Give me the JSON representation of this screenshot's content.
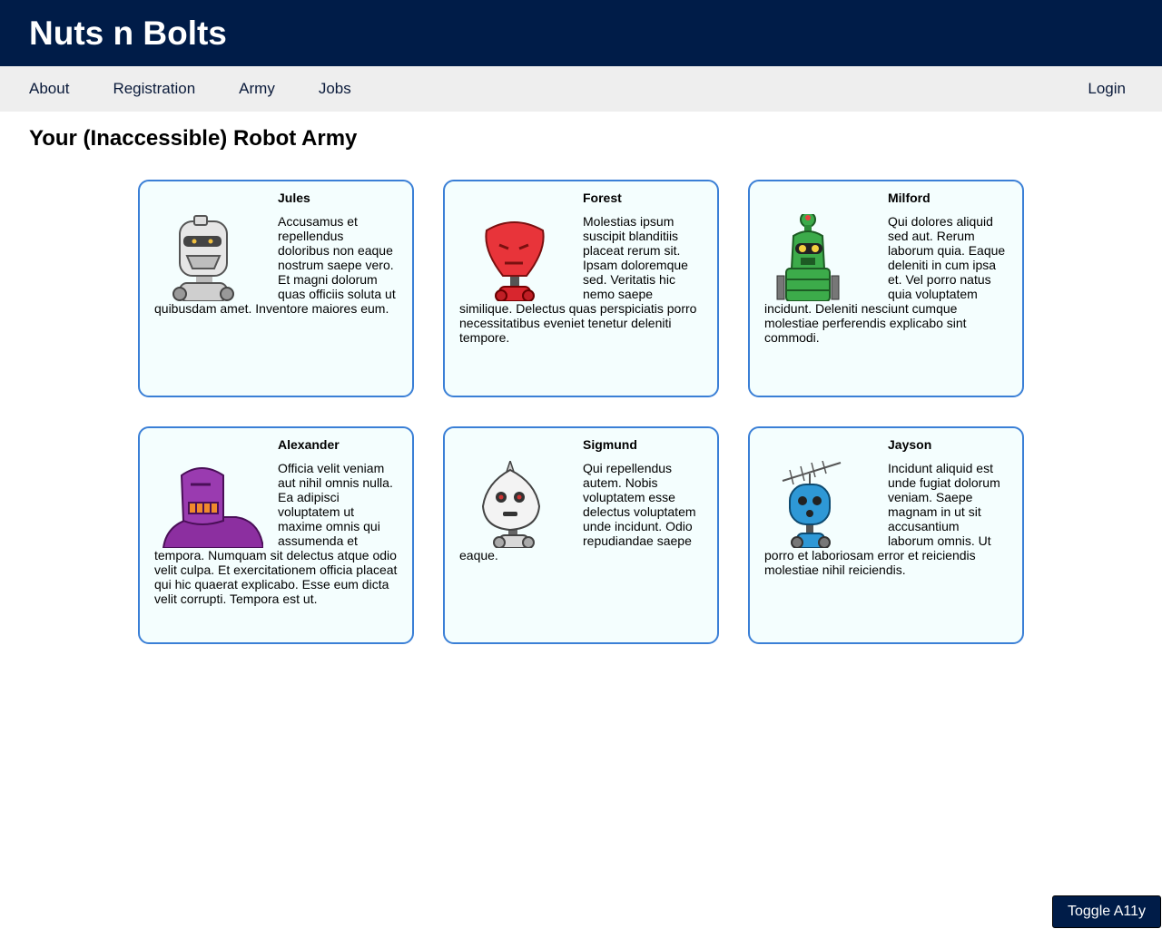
{
  "header": {
    "title": "Nuts n Bolts"
  },
  "nav": {
    "about": "About",
    "registration": "Registration",
    "army": "Army",
    "jobs": "Jobs",
    "login": "Login"
  },
  "main": {
    "title": "Your (Inaccessible) Robot Army"
  },
  "robots": [
    {
      "name": "Jules",
      "description": "Accusamus et repellendus doloribus non eaque nostrum saepe vero. Et magni dolorum quas officiis soluta ut quibusdam amet. Inventore maiores eum.",
      "color": "#d8d8d8"
    },
    {
      "name": "Forest",
      "description": "Molestias ipsum suscipit blanditiis placeat rerum sit. Ipsam doloremque sed. Veritatis hic nemo saepe similique. Delectus quas perspiciatis porro necessitatibus eveniet tenetur deleniti tempore.",
      "color": "#e8343a"
    },
    {
      "name": "Milford",
      "description": "Qui dolores aliquid sed aut. Rerum laborum quia. Eaque deleniti in cum ipsa et. Vel porro natus quia voluptatem incidunt. Deleniti nesciunt cumque molestiae perferendis explicabo sint commodi.",
      "color": "#3cab4a"
    },
    {
      "name": "Alexander",
      "description": "Officia velit veniam aut nihil omnis nulla. Ea adipisci voluptatem ut maxime omnis qui assumenda et tempora. Numquam sit delectus atque odio velit culpa. Et exercitationem officia placeat qui hic quaerat explicabo. Esse eum dicta velit corrupti. Tempora est ut.",
      "color": "#8c2fa0"
    },
    {
      "name": "Sigmund",
      "description": "Qui repellendus autem. Nobis voluptatem esse delectus voluptatem unde incidunt. Odio repudiandae saepe eaque.",
      "color": "#f0f0f0"
    },
    {
      "name": "Jayson",
      "description": "Incidunt aliquid est unde fugiat dolorum veniam. Saepe magnam in ut sit accusantium laborum omnis. Ut porro et laboriosam error et reiciendis molestiae nihil reiciendis.",
      "color": "#2e98d6"
    }
  ],
  "toggle": {
    "label": "Toggle A11y"
  }
}
